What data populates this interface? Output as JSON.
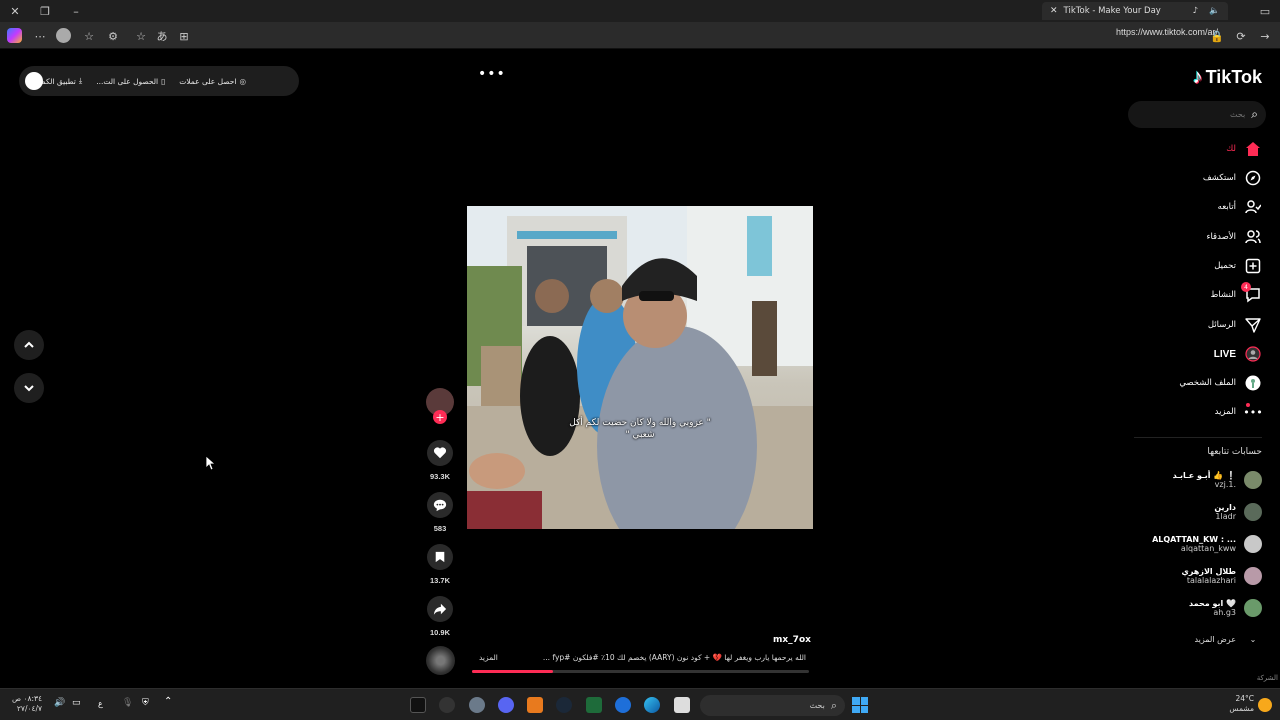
{
  "browser": {
    "tab_title": "TikTok - Make Your Day",
    "url": "https://www.tiktok.com/ar/"
  },
  "promo": {
    "desktop_app": "تطبيق الكمبيوتر",
    "get_app": "الحصول على الت...",
    "get_coins": "احصل على عملات"
  },
  "logo": "TikTok",
  "search": {
    "placeholder": "بحث"
  },
  "nav": [
    {
      "label": "لك",
      "icon": "home-icon",
      "active": true
    },
    {
      "label": "استكشف",
      "icon": "compass-icon"
    },
    {
      "label": "أتابعه",
      "icon": "following-icon"
    },
    {
      "label": "الأصدقاء",
      "icon": "friends-icon"
    },
    {
      "label": "تحميل",
      "icon": "upload-icon"
    },
    {
      "label": "النشاط",
      "icon": "activity-icon",
      "badge": "4"
    },
    {
      "label": "الرسائل",
      "icon": "messages-icon"
    },
    {
      "label": "LIVE",
      "icon": "live-icon"
    },
    {
      "label": "الملف الشخصي",
      "icon": "profile-icon"
    },
    {
      "label": "المزيد",
      "icon": "more-icon"
    }
  ],
  "following": {
    "title": "حسابات تتابعها",
    "accounts": [
      {
        "name": "أبـو عـابـد 👍 ❕",
        "handle": "vzj.1."
      },
      {
        "name": "دارين",
        "handle": "1ladr"
      },
      {
        "name": "ALQATTAN_KW : ...",
        "handle": "alqattan_kww"
      },
      {
        "name": "طلال الازهري",
        "handle": "talalalazhari"
      },
      {
        "name": "ابو محمد 🤍",
        "handle": "ah.g3"
      }
    ],
    "show_more": "عرض المزيد"
  },
  "video": {
    "overlay_caption_line1": "\" عزوبي والله ولا كان حضيت لكم أكل",
    "overlay_caption_line2": "شعبي \"",
    "author": "mx_7ox",
    "description": "الله يرحمها يارب ويغفر لها 💔 + كود نون (AARY) يخصم لك 10٪ #فلكون #fyp ...",
    "more_label": "المزيد",
    "progress": 0.24
  },
  "actions": {
    "likes": "93.3K",
    "comments": "583",
    "saves": "13.7K",
    "shares": "10.9K"
  },
  "footer_company": "الشركة",
  "taskbar": {
    "search_label": "بحث",
    "time": "٠٨:٣٤ ص",
    "date": "٢٧/٠٤/٧",
    "lang": "ع",
    "temperature": "24°C",
    "weather": "مشمس"
  },
  "colors": {
    "accent": "#fe2c55",
    "background": "#000000",
    "panel": "#1e1e1e"
  }
}
